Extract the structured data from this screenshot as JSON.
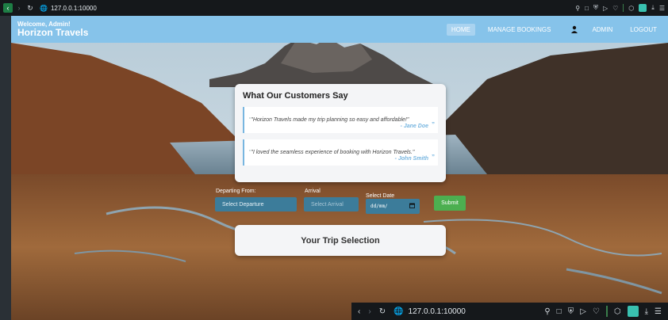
{
  "browser": {
    "url": "127.0.0.1:10000",
    "icons": [
      "back-icon",
      "forward-icon",
      "reload-icon",
      "site-info-icon",
      "pin-icon",
      "tab-icon",
      "shield-icon",
      "play-icon",
      "heart-icon",
      "extensions-icon",
      "extension-icon",
      "download-icon",
      "menu-icon"
    ]
  },
  "navbar": {
    "welcome": "Welcome, Admin!",
    "brand": "Horizon Travels",
    "items": [
      {
        "label": "HOME",
        "active": true
      },
      {
        "label": "MANAGE BOOKINGS",
        "active": false
      },
      {
        "label": "ADMIN",
        "active": false
      },
      {
        "label": "LOGOUT",
        "active": false
      }
    ]
  },
  "testimonials": {
    "title": "What Our Customers Say",
    "quotes": [
      {
        "text": "\"Horizon Travels made my trip planning so easy and affordable!\"",
        "author": "- Jane Doe"
      },
      {
        "text": "\"I loved the seamless experience of booking with Horizon Travels.\"",
        "author": "- John Smith"
      }
    ]
  },
  "form": {
    "departing_label": "Departing From:",
    "departing_value": "Select Departure",
    "arrival_label": "Arrival",
    "arrival_value": "Select Arrival",
    "date_label": "Select Date",
    "date_placeholder": "dd/mm/",
    "submit_label": "Submit"
  },
  "trip": {
    "title": "Your Trip Selection"
  },
  "colors": {
    "navbar": "#86c3ea",
    "accent": "#78b6e0",
    "field": "#3c7c9a",
    "submit": "#4caf50"
  }
}
